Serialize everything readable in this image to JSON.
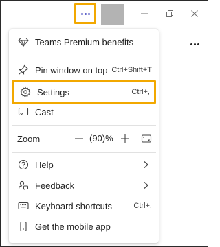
{
  "titlebar": {
    "more_icon": "more-horizontal-icon",
    "accent_color": "#5b5fc7",
    "highlight_color": "#f2a800"
  },
  "menu": {
    "premium": {
      "label": "Teams Premium benefits",
      "icon": "diamond-icon"
    },
    "pin": {
      "label": "Pin window on top",
      "shortcut": "Ctrl+Shift+T",
      "icon": "pin-icon"
    },
    "settings": {
      "label": "Settings",
      "shortcut": "Ctrl+,",
      "icon": "gear-icon"
    },
    "cast": {
      "label": "Cast",
      "icon": "cast-icon"
    },
    "zoom": {
      "label": "Zoom",
      "value": "(90)%"
    },
    "help": {
      "label": "Help",
      "icon": "help-circle-icon"
    },
    "feedback": {
      "label": "Feedback",
      "icon": "feedback-icon"
    },
    "keyboard": {
      "label": "Keyboard shortcuts",
      "shortcut": "Ctrl+.",
      "icon": "keyboard-icon"
    },
    "mobile": {
      "label": "Get the mobile app",
      "icon": "phone-icon"
    }
  }
}
